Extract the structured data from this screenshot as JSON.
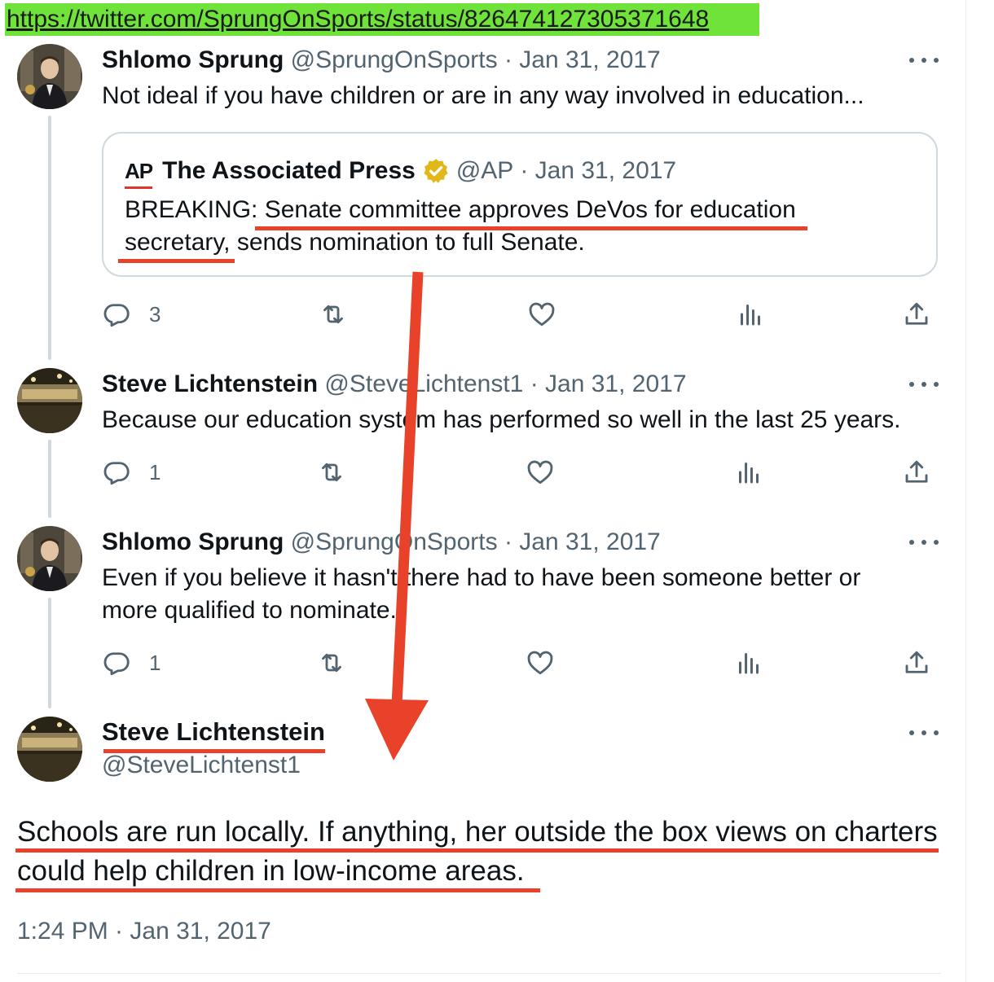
{
  "url": "https://twitter.com/SprungOnSports/status/826474127305371648",
  "tweets": [
    {
      "name": "Shlomo Sprung",
      "handle": "@SprungOnSports",
      "date": "· Jan 31, 2017",
      "text": "Not ideal if you have children or are in any way involved in education...",
      "reply_count": "3",
      "quote": {
        "logo": "AP",
        "name": "The Associated Press",
        "handle": "@AP",
        "date": "· Jan 31, 2017",
        "text": "BREAKING: Senate committee approves DeVos for education secretary, sends nomination to full Senate."
      }
    },
    {
      "name": "Steve Lichtenstein",
      "handle": "@SteveLichtenst1",
      "date": "· Jan 31, 2017",
      "text": "Because our education system has performed so well in the last 25 years.",
      "reply_count": "1"
    },
    {
      "name": "Shlomo Sprung",
      "handle": "@SprungOnSports",
      "date": "· Jan 31, 2017",
      "text": "Even if you believe it hasn't there had to have been someone better or more qualified to nominate.",
      "reply_count": "1"
    }
  ],
  "focal": {
    "name": "Steve Lichtenstein",
    "handle": "@SteveLichtenst1",
    "text": "Schools are run locally. If anything, her outside the box views on charters could help children in low-income areas.",
    "timestamp": "1:24 PM · Jan 31, 2017"
  },
  "icons": {
    "reply": "reply-icon",
    "retweet": "retweet-icon",
    "like": "like-icon",
    "views": "views-icon",
    "share": "share-icon",
    "more": "more-icon",
    "verified": "verified-badge-icon"
  },
  "colors": {
    "url_highlight": "#6fe33a",
    "annotation_red": "#e8432a",
    "verified_gold": "#e2b719",
    "muted_text": "#536471",
    "thread_line": "#cfd9de"
  }
}
